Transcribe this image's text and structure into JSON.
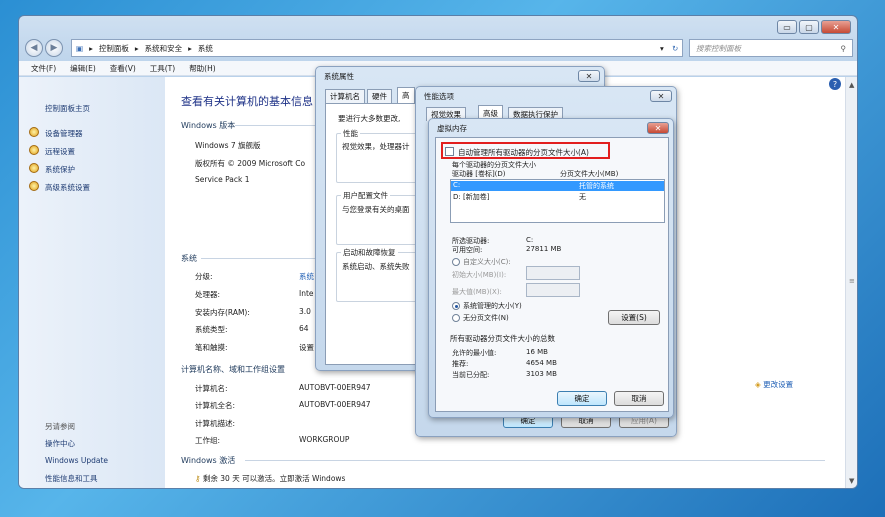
{
  "window": {
    "min": "▭",
    "max": "▢",
    "close": "✕"
  },
  "address": {
    "seg1": "控制面板",
    "seg2": "系统和安全",
    "seg3": "系统",
    "search_placeholder": "搜索控制面板"
  },
  "menu": [
    "文件(F)",
    "编辑(E)",
    "查看(V)",
    "工具(T)",
    "帮助(H)"
  ],
  "sidebar": {
    "home": "控制面板主页",
    "items": [
      "设备管理器",
      "远程设置",
      "系统保护",
      "高级系统设置"
    ],
    "see_also": "另请参阅",
    "links": [
      "操作中心",
      "Windows Update",
      "性能信息和工具"
    ]
  },
  "main": {
    "title": "查看有关计算机的基本信息",
    "edition_hdr": "Windows 版本",
    "edition": "Windows 7 旗舰版",
    "copyright": "版权所有 © 2009 Microsoft Co",
    "sp": "Service Pack 1",
    "system_hdr": "系统",
    "rows": [
      {
        "k": "分级:",
        "v": "系统"
      },
      {
        "k": "处理器:",
        "v": "Inte"
      },
      {
        "k": "安装内存(RAM):",
        "v": "3.0"
      },
      {
        "k": "系统类型:",
        "v": "64"
      },
      {
        "k": "笔和触摸:",
        "v": "设置"
      }
    ],
    "comp_hdr": "计算机名称、域和工作组设置",
    "comp_rows": [
      {
        "k": "计算机名:",
        "v": "AUTOBVT-00ER947"
      },
      {
        "k": "计算机全名:",
        "v": "AUTOBVT-00ER947"
      },
      {
        "k": "计算机描述:",
        "v": ""
      },
      {
        "k": "工作组:",
        "v": "WORKGROUP"
      }
    ],
    "change": "更改设置",
    "act_hdr": "Windows 激活",
    "act_text": "剩余 30 天 可以激活。立即激活 Windows"
  },
  "sysprops": {
    "title": "系统属性",
    "tabs": [
      "计算机名",
      "硬件",
      "高"
    ],
    "intro": "要进行大多数更改,",
    "perf_lbl": "性能",
    "perf_text": "视觉效果，处理器计",
    "profile_lbl": "用户配置文件",
    "profile_text": "与您登录有关的桌面",
    "startup_lbl": "启动和故障恢复",
    "startup_text": "系统启动、系统失败"
  },
  "perfopt": {
    "title": "性能选项",
    "tabs": [
      "视觉效果",
      "高级",
      "数据执行保护"
    ],
    "ok": "确定",
    "cancel": "取消",
    "apply": "应用(A)"
  },
  "vmem": {
    "title": "虚拟内存",
    "auto": "自动管理所有驱动器的分页文件大小(A)",
    "group": "每个驱动器的分页文件大小",
    "col1": "驱动器 [卷标](D)",
    "col2": "分页文件大小(MB)",
    "drives": [
      {
        "d": "C:",
        "size": "托管的系统"
      },
      {
        "d": "D:    [新加卷]",
        "size": "无"
      }
    ],
    "sel_lbl": "所选驱动器:",
    "sel_val": "C:",
    "free_lbl": "可用空间:",
    "free_val": "27811 MB",
    "custom": "自定义大小(C):",
    "init": "初始大小(MB)(I):",
    "max": "最大值(MB)(X):",
    "managed": "系统管理的大小(Y)",
    "none": "无分页文件(N)",
    "set": "设置(S)",
    "total_hdr": "所有驱动器分页文件大小的总数",
    "min_lbl": "允许的最小值:",
    "min_val": "16 MB",
    "rec_lbl": "推荐:",
    "rec_val": "4654 MB",
    "cur_lbl": "当前已分配:",
    "cur_val": "3103 MB",
    "ok": "确定",
    "cancel": "取消"
  }
}
